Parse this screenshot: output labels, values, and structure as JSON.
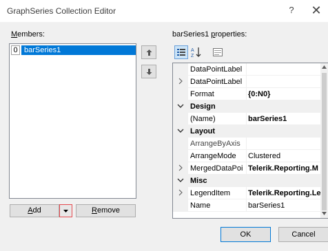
{
  "window": {
    "title": "GraphSeries Collection Editor",
    "help_glyph": "?",
    "close_glyph": "✕"
  },
  "members": {
    "label": "Members:",
    "items": [
      {
        "index": "0",
        "name": "barSeries1",
        "selected": true
      }
    ]
  },
  "move_buttons": {
    "up_icon": "arrow-up-icon",
    "down_icon": "arrow-down-icon"
  },
  "member_buttons": {
    "add_label": "Add",
    "remove_label": "Remove"
  },
  "properties": {
    "label": "barSeries1 properties:",
    "toolbar": [
      "categorized-icon",
      "alphabetical-icon",
      "property-pages-icon"
    ],
    "rows": [
      {
        "kind": "prop",
        "expandable": false,
        "name": "DataPointLabel",
        "value": ""
      },
      {
        "kind": "prop",
        "expandable": true,
        "name": "DataPointLabel",
        "value": ""
      },
      {
        "kind": "prop",
        "expandable": false,
        "name": "Format",
        "value": "{0:N0}",
        "bold": true
      },
      {
        "kind": "category",
        "name": "Design"
      },
      {
        "kind": "prop",
        "expandable": false,
        "name": "(Name)",
        "value": "barSeries1",
        "bold": true
      },
      {
        "kind": "category",
        "name": "Layout"
      },
      {
        "kind": "prop",
        "expandable": false,
        "name": "ArrangeByAxis",
        "value": "",
        "dim": true
      },
      {
        "kind": "prop",
        "expandable": false,
        "name": "ArrangeMode",
        "value": "Clustered"
      },
      {
        "kind": "prop",
        "expandable": true,
        "name": "MergedDataPoi",
        "value": "Telerik.Reporting.M",
        "bold": true
      },
      {
        "kind": "category",
        "name": "Misc"
      },
      {
        "kind": "prop",
        "expandable": true,
        "name": "LegendItem",
        "value": "Telerik.Reporting.Le",
        "bold": true
      },
      {
        "kind": "prop",
        "expandable": false,
        "name": "Name",
        "value": "barSeries1"
      }
    ]
  },
  "footer": {
    "ok_label": "OK",
    "cancel_label": "Cancel"
  },
  "colors": {
    "selection": "#0078d7",
    "dialog_bg": "#f0f0f0",
    "drop_border": "#e5484d"
  }
}
